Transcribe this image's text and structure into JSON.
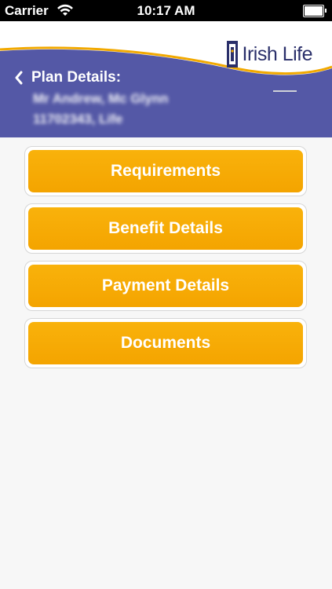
{
  "status_bar": {
    "carrier": "Carrier",
    "time": "10:17 AM"
  },
  "header": {
    "back_label": "Plan Details:",
    "name_line": "Mr Andrew, Mc Glynn",
    "policy_line": "11702343, Life",
    "logo_text": "Irish Life"
  },
  "menu": {
    "items": [
      {
        "label": "Requirements"
      },
      {
        "label": "Benefit Details"
      },
      {
        "label": "Payment Details"
      },
      {
        "label": "Documents"
      }
    ]
  },
  "colors": {
    "header_band": "#5458a6",
    "accent_orange": "#f5a800",
    "logo_navy": "#2a2f6a"
  }
}
